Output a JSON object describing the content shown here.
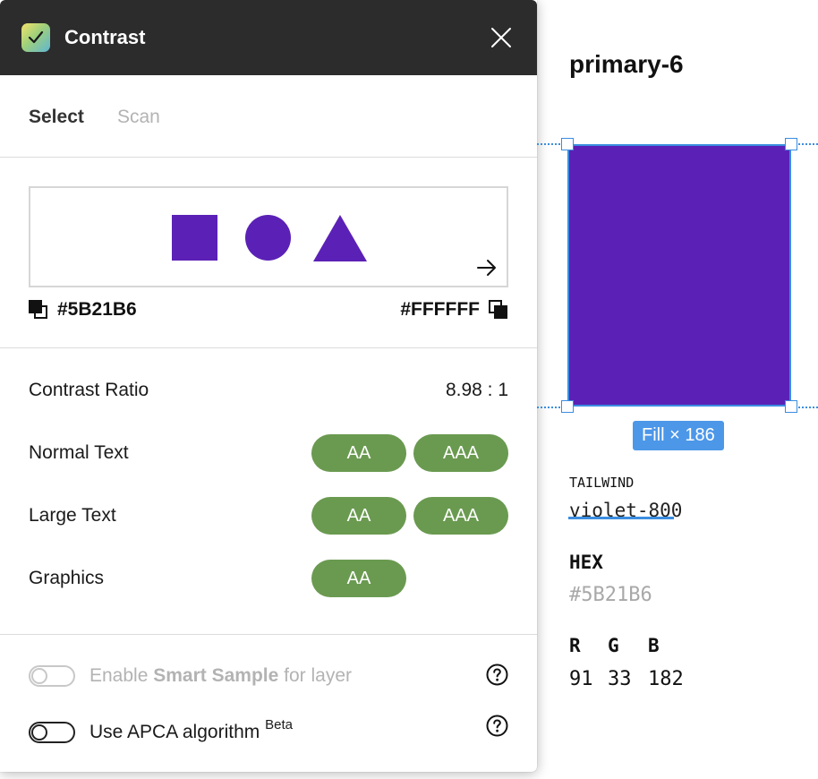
{
  "panel": {
    "title": "Contrast",
    "tabs": [
      {
        "label": "Select",
        "active": true
      },
      {
        "label": "Scan",
        "active": false
      }
    ],
    "preview": {
      "shape_color": "#5B21B6",
      "background": "#FFFFFF",
      "shapes": [
        "square-icon",
        "circle-icon",
        "triangle-icon"
      ]
    },
    "foreground_color": "#5B21B6",
    "background_color": "#FFFFFF",
    "results": {
      "ratio_label": "Contrast Ratio",
      "ratio_value": "8.98 : 1",
      "rows": [
        {
          "label": "Normal Text",
          "badges": [
            "AA",
            "AAA"
          ]
        },
        {
          "label": "Large Text",
          "badges": [
            "AA",
            "AAA"
          ]
        },
        {
          "label": "Graphics",
          "badges": [
            "AA"
          ]
        }
      ],
      "pass_color": "#6A9A50"
    },
    "options": {
      "smart_sample": {
        "prefix": "Enable ",
        "bold": "Smart Sample",
        "suffix": " for layer",
        "enabled": false,
        "disabled": true
      },
      "apca": {
        "label": "Use APCA algorithm ",
        "sup": "Beta",
        "enabled": false
      }
    }
  },
  "canvas": {
    "frame_title": "primary-6",
    "fill_color": "#5B21B6",
    "selection_color": "#3B8DE0",
    "size_badge": "Fill × 186",
    "tailwind_label": "TAILWIND",
    "tailwind_value": "violet-800",
    "hex_label": "HEX",
    "hex_value": "#5B21B6",
    "rgb_labels": [
      "R",
      "G",
      "B"
    ],
    "rgb_values": [
      "91",
      "33",
      "182"
    ]
  }
}
